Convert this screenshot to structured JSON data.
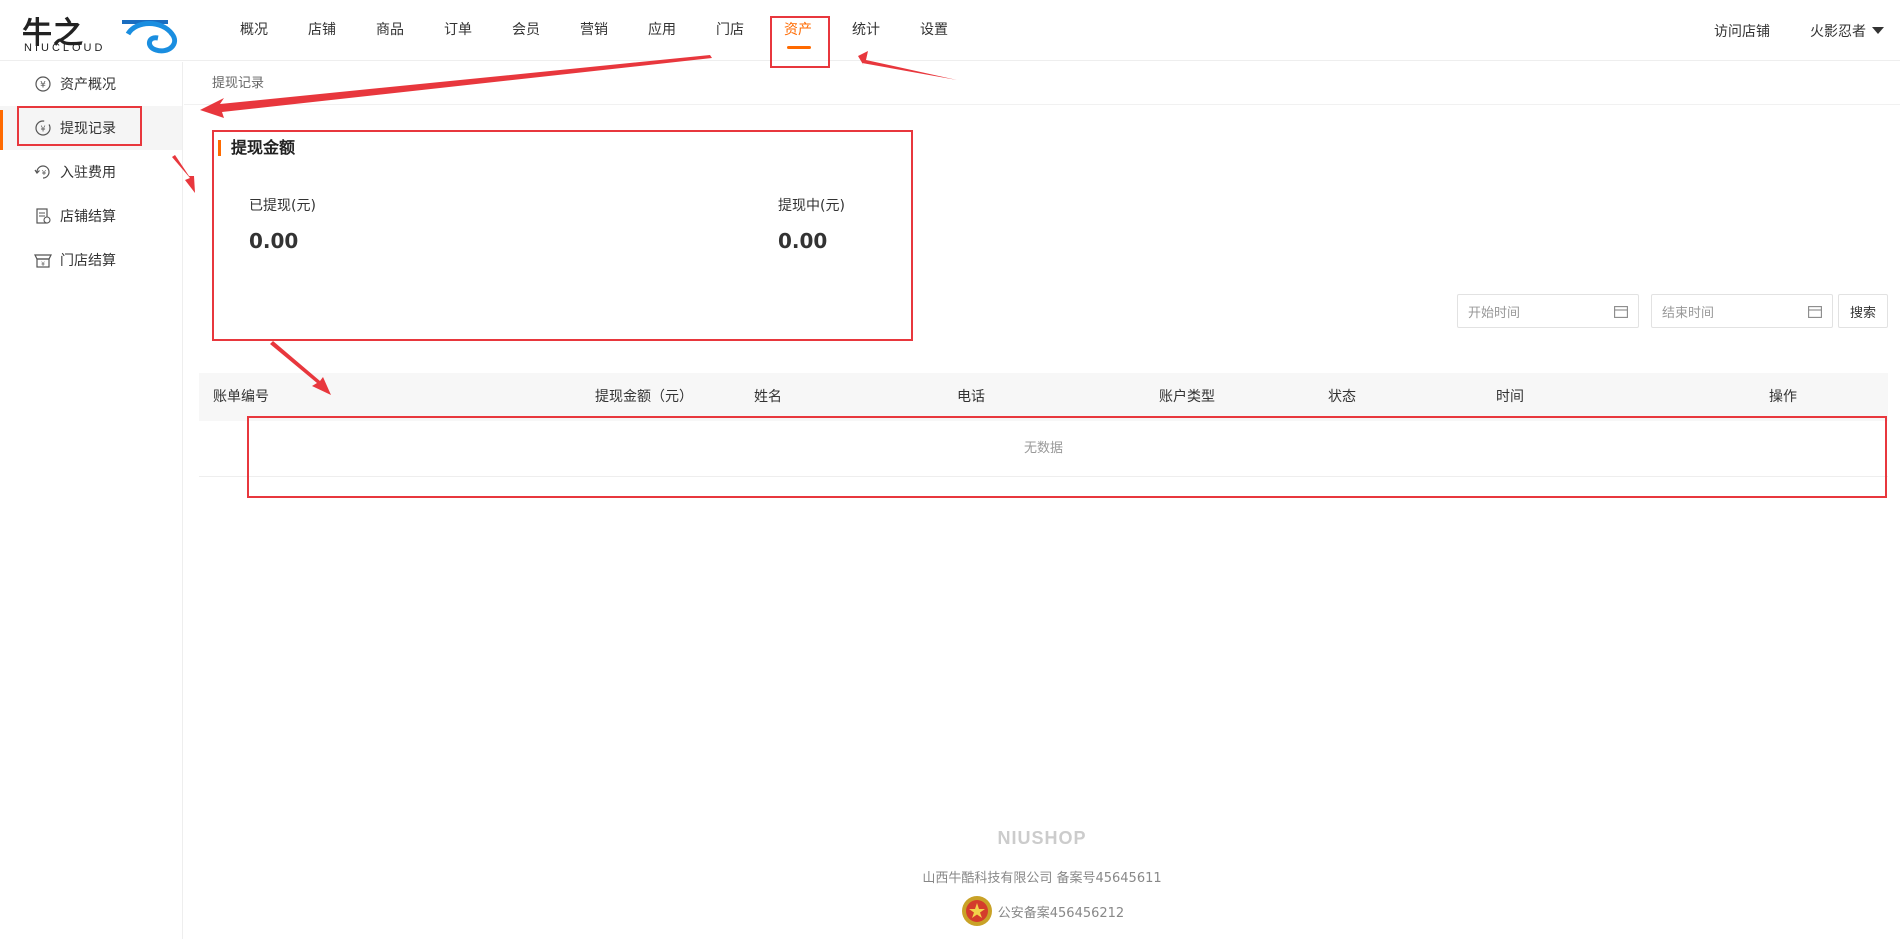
{
  "header": {
    "logo_cn": "牛之",
    "logo_en": "NIUCLOUD",
    "nav": [
      "概况",
      "店铺",
      "商品",
      "订单",
      "会员",
      "营销",
      "应用",
      "门店",
      "资产",
      "统计",
      "设置"
    ],
    "visit_store": "访问店铺",
    "username": "火影忍者"
  },
  "sidebar": {
    "items": [
      {
        "label": "资产概况",
        "icon": "yen-circle-icon"
      },
      {
        "label": "提现记录",
        "icon": "withdraw-record-icon"
      },
      {
        "label": "入驻费用",
        "icon": "settle-fee-icon"
      },
      {
        "label": "店铺结算",
        "icon": "store-settlement-icon"
      },
      {
        "label": "门店结算",
        "icon": "shop-settlement-icon"
      }
    ]
  },
  "breadcrumb": "提现记录",
  "stats": {
    "title": "提现金额",
    "withdrawn_label": "已提现(元)",
    "withdrawn_value": "0.00",
    "pending_label": "提现中(元)",
    "pending_value": "0.00"
  },
  "filters": {
    "start_placeholder": "开始时间",
    "end_placeholder": "结束时间",
    "search_label": "搜索"
  },
  "table": {
    "columns": [
      "账单编号",
      "提现金额（元）",
      "姓名",
      "电话",
      "账户类型",
      "状态",
      "时间",
      "操作"
    ],
    "empty_text": "无数据"
  },
  "footer": {
    "brand": "NIUSHOP",
    "company": "山西牛酷科技有限公司  备案号45645611",
    "police": "公安备案456456212"
  },
  "colors": {
    "accent": "#ff6a00",
    "annotation": "#e8373d"
  }
}
